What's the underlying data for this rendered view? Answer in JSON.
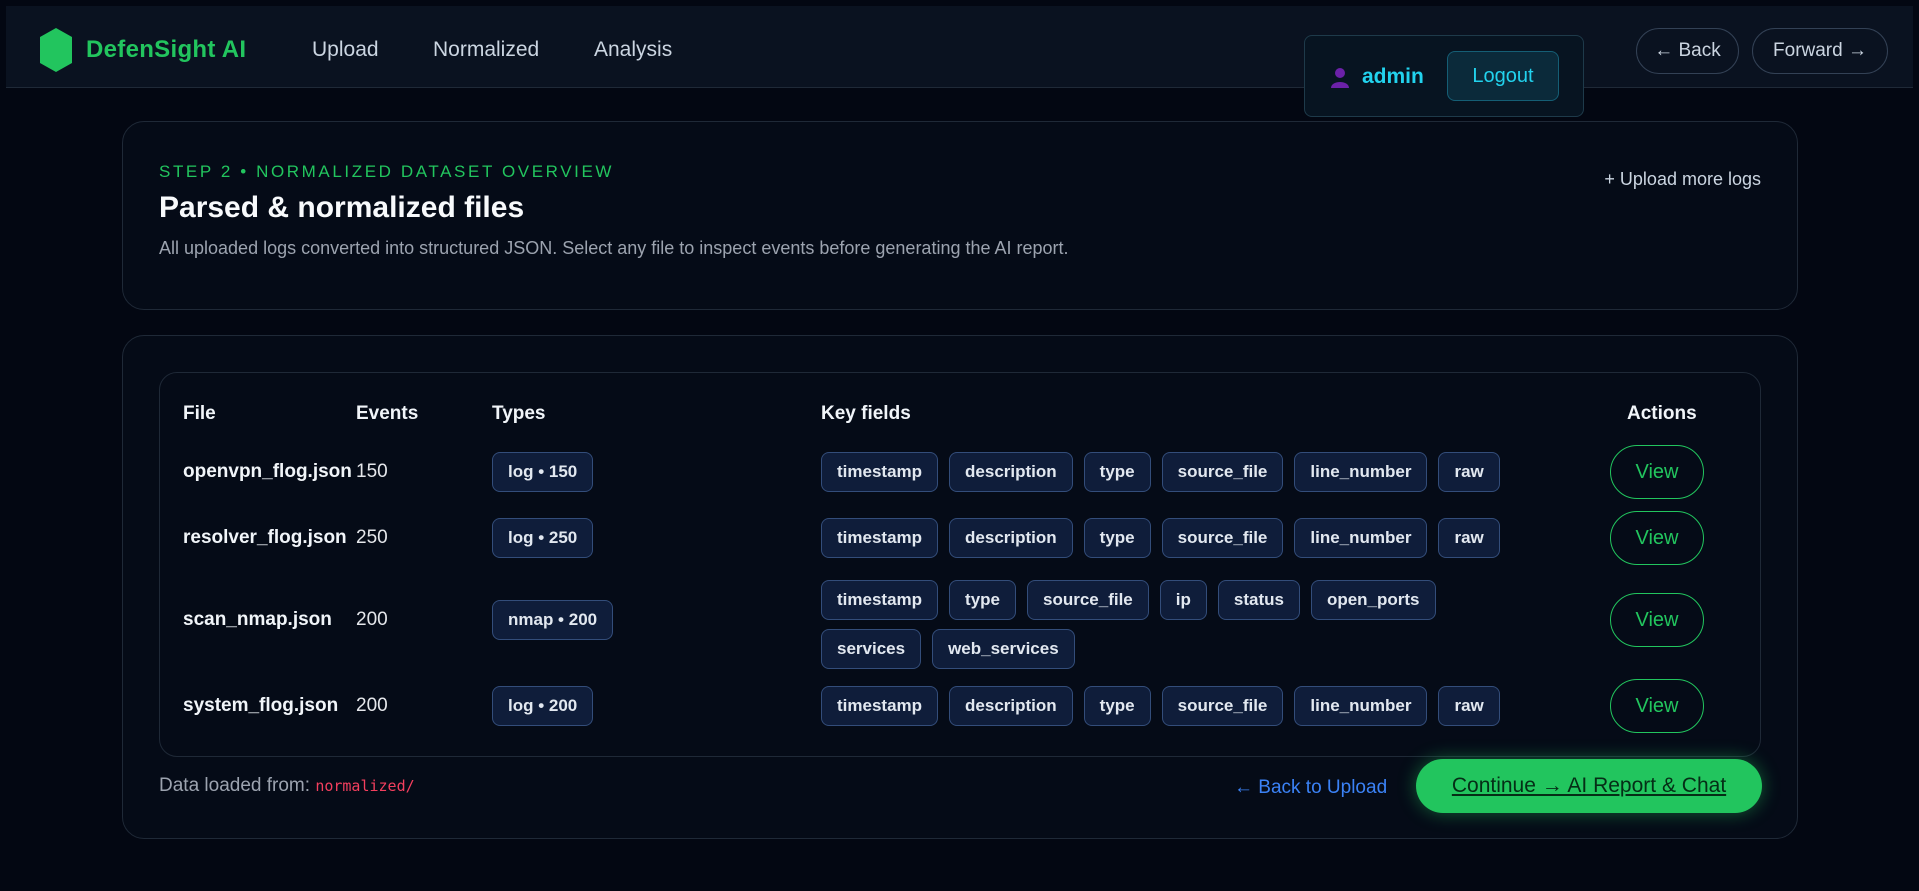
{
  "nav": {
    "brand": "DefenSight AI",
    "links": [
      "Upload",
      "Normalized",
      "Analysis"
    ],
    "back": "← Back",
    "forward": "Forward →",
    "brand_color": "#22c55e"
  },
  "user": {
    "name": "admin",
    "logout": "Logout"
  },
  "overview": {
    "step": "STEP 2 • NORMALIZED DATASET OVERVIEW",
    "title": "Parsed & normalized files",
    "subtitle": "All uploaded logs converted into structured JSON. Select any file to inspect events before generating the AI report.",
    "upload_more": "+ Upload more logs"
  },
  "table": {
    "headers": {
      "file": "File",
      "events": "Events",
      "types": "Types",
      "key_fields": "Key fields",
      "actions": "Actions"
    },
    "view_label": "View",
    "rows": [
      {
        "file": "openvpn_flog.json",
        "events": "150",
        "type": "log • 150",
        "fields": [
          "timestamp",
          "description",
          "type",
          "source_file",
          "line_number",
          "raw"
        ]
      },
      {
        "file": "resolver_flog.json",
        "events": "250",
        "type": "log • 250",
        "fields": [
          "timestamp",
          "description",
          "type",
          "source_file",
          "line_number",
          "raw"
        ]
      },
      {
        "file": "scan_nmap.json",
        "events": "200",
        "type": "nmap • 200",
        "fields": [
          "timestamp",
          "type",
          "source_file",
          "ip",
          "status",
          "open_ports",
          "services",
          "web_services"
        ]
      },
      {
        "file": "system_flog.json",
        "events": "200",
        "type": "log • 200",
        "fields": [
          "timestamp",
          "description",
          "type",
          "source_file",
          "line_number",
          "raw"
        ]
      }
    ]
  },
  "footer": {
    "data_loaded_label": "Data loaded from:",
    "data_path": "normalized/",
    "back_to_upload": "← Back to Upload",
    "continue": "Continue → AI Report & Chat"
  }
}
